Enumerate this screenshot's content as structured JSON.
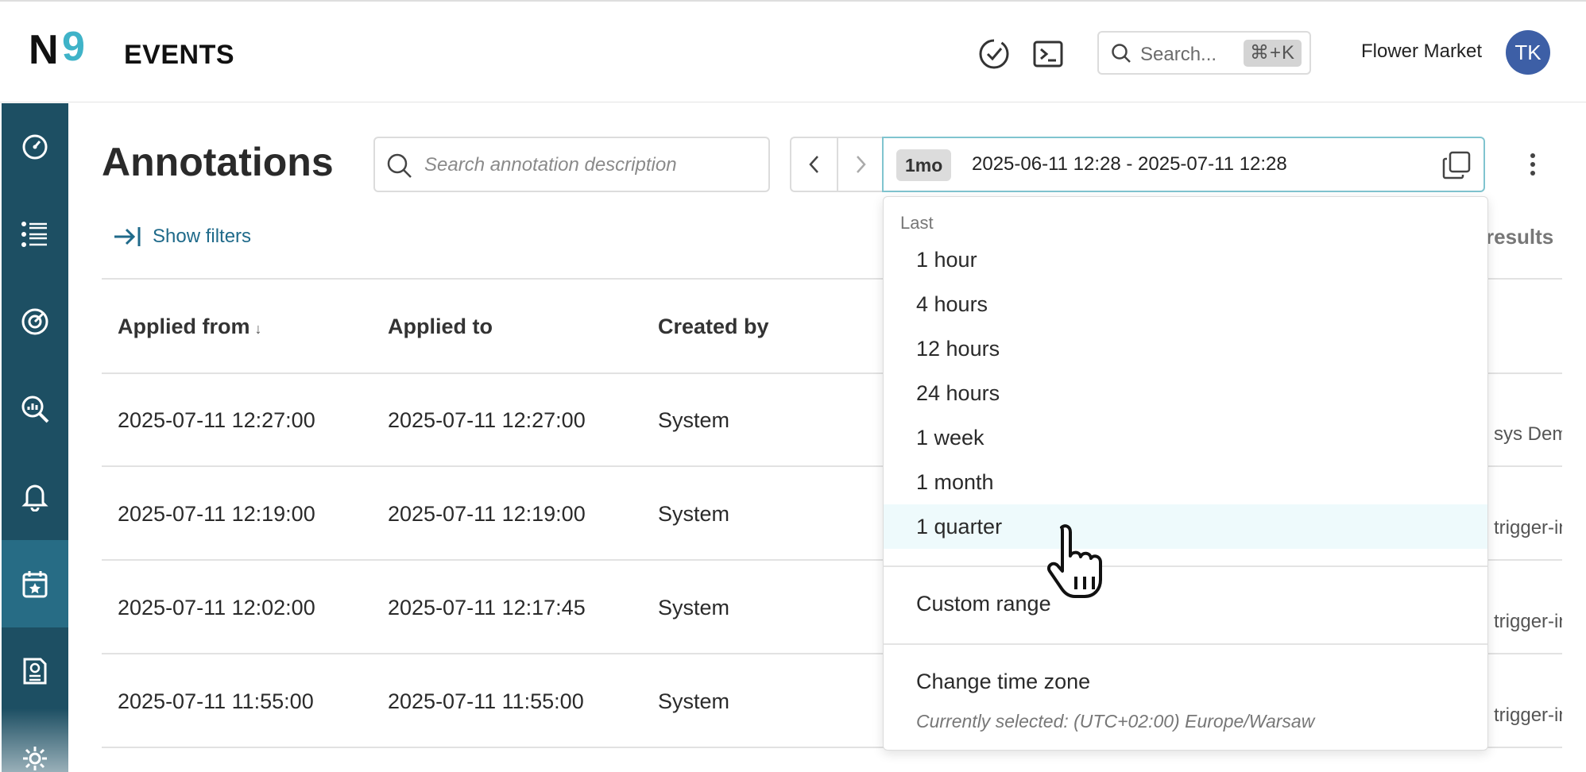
{
  "app": {
    "logo_text": "N9",
    "title": "EVENTS"
  },
  "header": {
    "search_placeholder": "Search...",
    "shortcut": "⌘+K",
    "organization": "Flower Market",
    "avatar_initials": "TK"
  },
  "page": {
    "title": "Annotations",
    "search_placeholder": "Search annotation description",
    "time_badge": "1mo",
    "time_range": "2025-06-11 12:28 - 2025-07-11 12:28",
    "show_filters": "Show filters",
    "results_label": "results"
  },
  "table": {
    "columns": [
      {
        "label": "Applied from",
        "sort": "desc"
      },
      {
        "label": "Applied to"
      },
      {
        "label": "Created by"
      }
    ],
    "rows": [
      {
        "from": "2025-07-11 12:27:00",
        "to": "2025-07-11 12:27:00",
        "created_by": "System",
        "trailing": "sys Demo"
      },
      {
        "from": "2025-07-11 12:19:00",
        "to": "2025-07-11 12:19:00",
        "created_by": "System",
        "trailing": "trigger-in"
      },
      {
        "from": "2025-07-11 12:02:00",
        "to": "2025-07-11 12:17:45",
        "created_by": "System",
        "trailing": "trigger-in"
      },
      {
        "from": "2025-07-11 11:55:00",
        "to": "2025-07-11 11:55:00",
        "created_by": "System",
        "trailing": "trigger-in"
      }
    ]
  },
  "dropdown": {
    "section_label": "Last",
    "options": [
      "1 hour",
      "4 hours",
      "12 hours",
      "24 hours",
      "1 week",
      "1 month",
      "1 quarter"
    ],
    "hovered": "1 quarter",
    "custom_range": "Custom range",
    "change_timezone": "Change time zone",
    "timezone_note": "Currently selected: (UTC+02:00) Europe/Warsaw"
  },
  "colors": {
    "sidebar": "#1d4f63",
    "sidebar_active": "#276c85",
    "accent": "#1f6a8a",
    "logo_nine": "#3fb3c8",
    "avatar": "#3d5fa6"
  },
  "icons": {
    "sidebar": [
      "dashboard-gauge-icon",
      "service-list-icon",
      "slo-target-icon",
      "query-analytics-icon",
      "alert-bell-icon",
      "calendar-star-icon",
      "report-icon",
      "settings-gear-icon"
    ]
  }
}
